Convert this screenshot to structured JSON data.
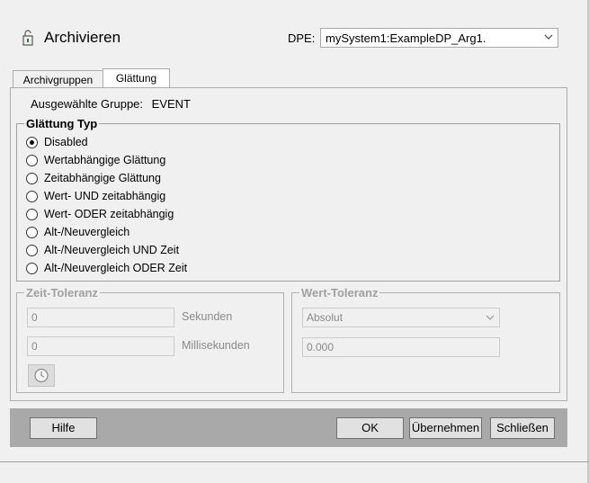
{
  "header": {
    "title": "Archivieren",
    "dpe_label": "DPE:",
    "dpe_value": "mySystem1:ExampleDP_Arg1."
  },
  "tabs": [
    {
      "label": "Archivgruppen",
      "active": false
    },
    {
      "label": "Glättung",
      "active": true
    }
  ],
  "group": {
    "label": "Ausgewählte Gruppe:",
    "value": "EVENT"
  },
  "smoothing": {
    "legend": "Glättung Typ",
    "options": [
      {
        "label": "Disabled",
        "checked": true
      },
      {
        "label": "Wertabhängige Glättung",
        "checked": false
      },
      {
        "label": "Zeitabhängige Glättung",
        "checked": false
      },
      {
        "label": "Wert- UND zeitabhängig",
        "checked": false
      },
      {
        "label": "Wert- ODER zeitabhängig",
        "checked": false
      },
      {
        "label": "Alt-/Neuvergleich",
        "checked": false
      },
      {
        "label": "Alt-/Neuvergleich UND Zeit",
        "checked": false
      },
      {
        "label": "Alt-/Neuvergleich ODER Zeit",
        "checked": false
      }
    ]
  },
  "time_tolerance": {
    "legend": "Zeit-Toleranz",
    "seconds_value": "0",
    "seconds_label": "Sekunden",
    "ms_value": "0",
    "ms_label": "Millisekunden"
  },
  "value_tolerance": {
    "legend": "Wert-Toleranz",
    "mode_value": "Absolut",
    "amount_value": "0.000"
  },
  "footer": {
    "help_label": "Hilfe",
    "ok_label": "OK",
    "apply_label": "Übernehmen",
    "close_label": "Schließen"
  }
}
